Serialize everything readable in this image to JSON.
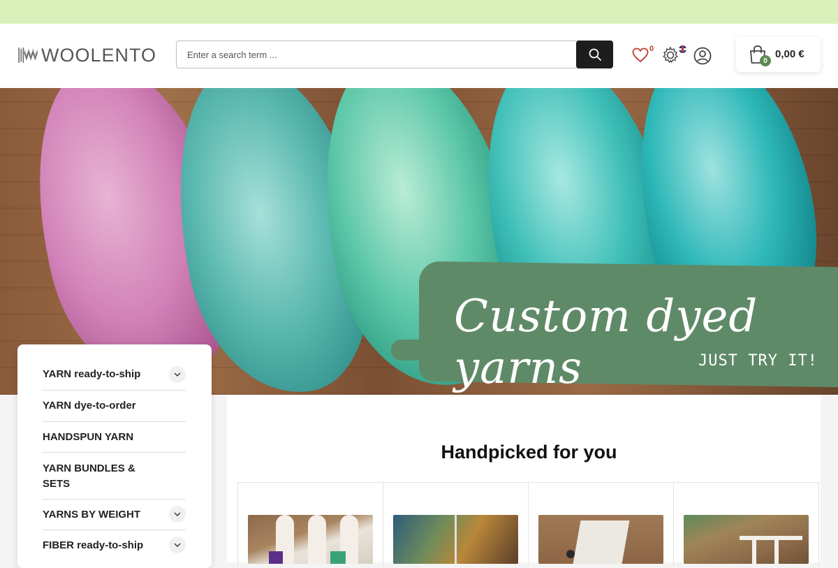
{
  "header": {
    "logo_text": "WOOLENTO",
    "search": {
      "placeholder": "Enter a search term ..."
    },
    "wishlist_count": "0",
    "cart": {
      "count": "0",
      "total": "0,00 €"
    }
  },
  "hero": {
    "title": "Custom dyed yarns",
    "subtitle": "JUST TRY IT!"
  },
  "sidebar": {
    "items": [
      {
        "label": "YARN ready-to-ship",
        "expandable": true
      },
      {
        "label": "YARN dye-to-order",
        "expandable": false
      },
      {
        "label": "HANDSPUN YARN",
        "expandable": false
      },
      {
        "label": "YARN BUNDLES & SETS",
        "expandable": false
      },
      {
        "label": "YARNS BY WEIGHT",
        "expandable": true
      },
      {
        "label": "FIBER ready-to-ship",
        "expandable": true
      }
    ]
  },
  "main": {
    "section_title": "Handpicked for you"
  },
  "colors": {
    "topbar": "#d9f0b8",
    "banner": "#5f8a68",
    "cart_badge": "#5b8a52",
    "wishlist_count": "#c0392b"
  }
}
